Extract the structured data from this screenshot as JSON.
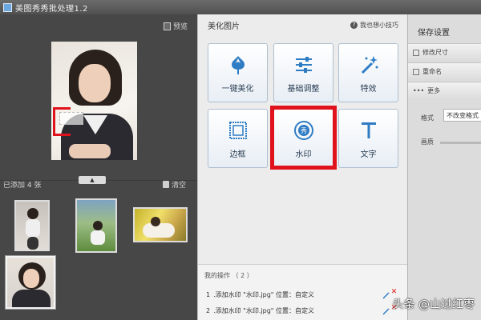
{
  "window": {
    "title": "美图秀秀批处理1.2"
  },
  "left": {
    "preview_label": "预览",
    "added_label": "已添加 4 张",
    "clear_label": "清空"
  },
  "mid": {
    "title": "美化图片",
    "tips": "我也想小技巧",
    "tiles": [
      {
        "label": "一键美化",
        "icon": "tulip-icon"
      },
      {
        "label": "基础调整",
        "icon": "sliders-icon"
      },
      {
        "label": "特效",
        "icon": "magic-wand-icon"
      },
      {
        "label": "边框",
        "icon": "frame-icon"
      },
      {
        "label": "水印",
        "icon": "watermark-seal-icon"
      },
      {
        "label": "文字",
        "icon": "text-T-icon"
      }
    ],
    "ops_title": "我的操作 （ 2 ）",
    "ops": [
      {
        "num": "1",
        "text": ".添加水印 \"水印.jpg\" 位置：自定义"
      },
      {
        "num": "2",
        "text": ".添加水印 \"水印.jpg\" 位置：自定义"
      }
    ]
  },
  "right": {
    "title": "保存设置",
    "resize": "修改尺寸",
    "rename": "重命名",
    "more": "更多",
    "format_label": "格式",
    "format_value": "不改变格式",
    "quality_label": "画质"
  },
  "overlay": {
    "watermark": "头条 @山过红枣"
  },
  "colors": {
    "highlight": "#e0121b",
    "tile_border": "#aebfd0",
    "accent": "#2f7cc4"
  }
}
